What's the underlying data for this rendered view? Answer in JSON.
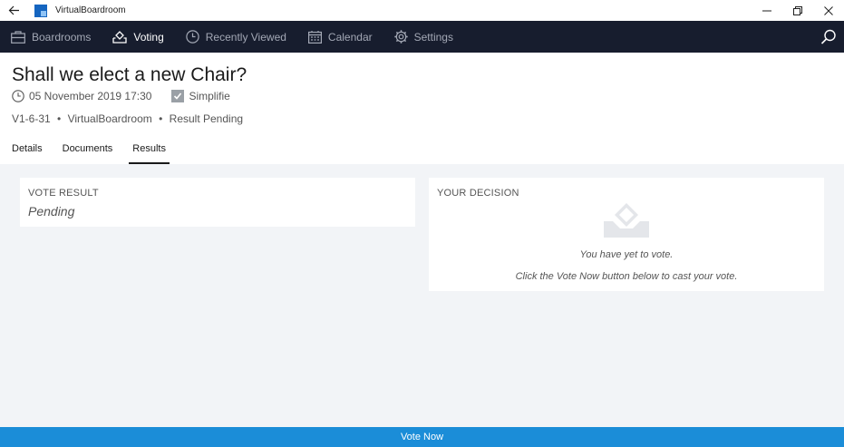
{
  "window": {
    "title": "VirtualBoardroom",
    "icons": {
      "back": "back-arrow-icon",
      "minimize": "minimize-icon",
      "restore": "restore-icon",
      "close": "close-icon"
    }
  },
  "nav": {
    "items": [
      {
        "label": "Boardrooms",
        "icon": "briefcase-icon",
        "active": false
      },
      {
        "label": "Voting",
        "icon": "ballot-icon",
        "active": true
      },
      {
        "label": "Recently Viewed",
        "icon": "clock-icon",
        "active": false
      },
      {
        "label": "Calendar",
        "icon": "calendar-icon",
        "active": false
      },
      {
        "label": "Settings",
        "icon": "gear-icon",
        "active": false
      }
    ],
    "search_icon": "search-icon"
  },
  "header": {
    "title": "Shall we elect a new Chair?",
    "date": "05 November 2019 17:30",
    "user": "Simplifie",
    "reference": "V1-6-31",
    "boardroom": "VirtualBoardroom",
    "status": "Result Pending",
    "separator": "•"
  },
  "tabs": [
    {
      "label": "Details",
      "active": false
    },
    {
      "label": "Documents",
      "active": false
    },
    {
      "label": "Results",
      "active": true
    }
  ],
  "vote_result": {
    "heading": "VOTE RESULT",
    "value": "Pending"
  },
  "your_decision": {
    "heading": "YOUR DECISION",
    "message1": "You have yet to vote.",
    "message2": "Click the Vote Now button below to cast your vote."
  },
  "vote_button": {
    "label": "Vote Now"
  },
  "colors": {
    "navbar": "#171d2e",
    "accent": "#1b8dd8",
    "background": "#f2f4f7"
  }
}
